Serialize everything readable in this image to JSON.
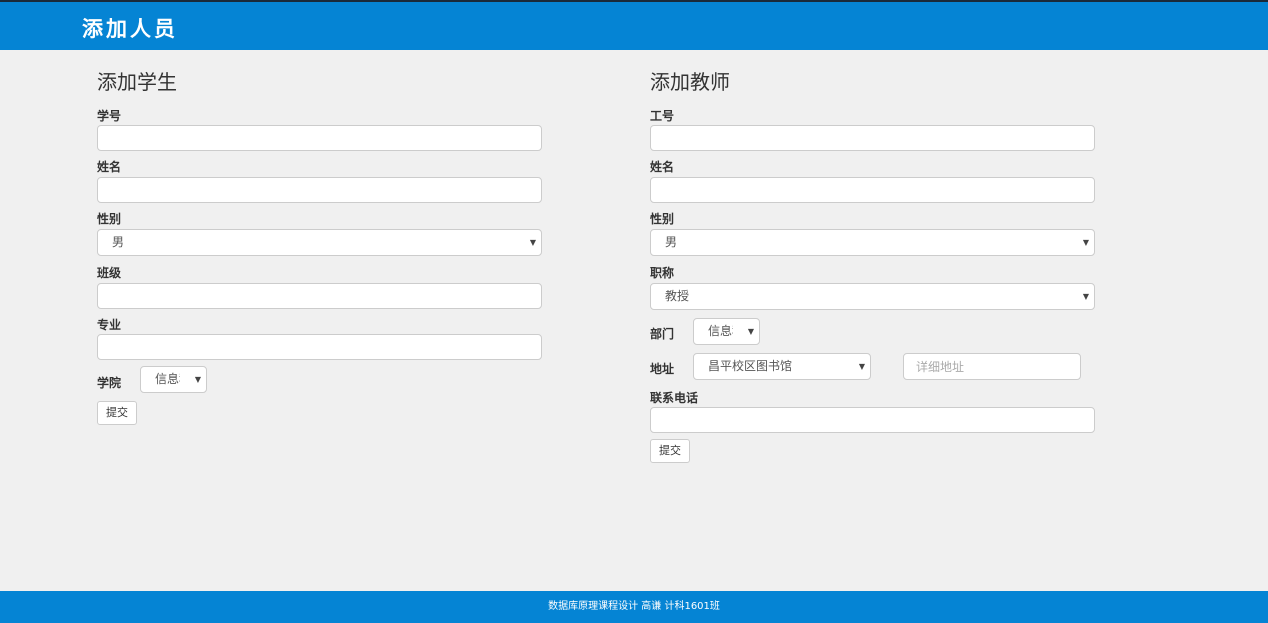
{
  "header": {
    "title": "添加人员"
  },
  "student": {
    "title": "添加学生",
    "id_label": "学号",
    "name_label": "姓名",
    "gender_label": "性别",
    "gender_value": "男",
    "class_label": "班级",
    "major_label": "专业",
    "college_label": "学院",
    "college_value": "信息科",
    "submit": "提交"
  },
  "teacher": {
    "title": "添加教师",
    "id_label": "工号",
    "name_label": "姓名",
    "gender_label": "性别",
    "gender_value": "男",
    "rank_label": "职称",
    "rank_value": "教授",
    "dept_label": "部门",
    "dept_value": "信息科",
    "addr_label": "地址",
    "addr_value": "昌平校区图书馆",
    "addr_detail_placeholder": "详细地址",
    "phone_label": "联系电话",
    "submit": "提交"
  },
  "footer": {
    "text": "数据库原理课程设计 高谦 计科1601班"
  },
  "colors": {
    "accent": "#0584d4"
  }
}
